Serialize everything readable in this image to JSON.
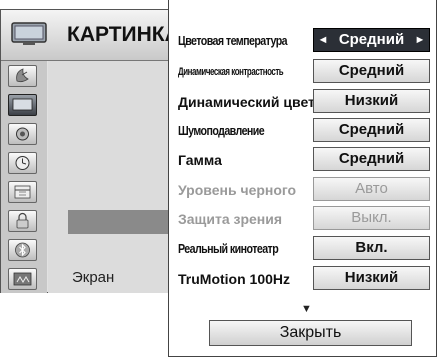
{
  "header": {
    "title": "КАРТИНКА"
  },
  "left_menu": {
    "icons": [
      "satellite-dish-icon",
      "picture-icon",
      "speaker-icon",
      "clock-icon",
      "calendar-icon",
      "lock-icon",
      "bluetooth-icon",
      "media-icon"
    ],
    "active_index": 1,
    "screen_label": "Экран"
  },
  "dialog": {
    "rows": [
      {
        "label": "Цветовая температура",
        "value": "Средний",
        "selected": true,
        "disabled": false
      },
      {
        "label": "Динамическая контрастность",
        "value": "Средний",
        "selected": false,
        "disabled": false
      },
      {
        "label": "Динамический цвет",
        "value": "Низкий",
        "selected": false,
        "disabled": false
      },
      {
        "label": "Шумоподавление",
        "value": "Средний",
        "selected": false,
        "disabled": false
      },
      {
        "label": "Гамма",
        "value": "Средний",
        "selected": false,
        "disabled": false
      },
      {
        "label": "Уровень черного",
        "value": "Авто",
        "selected": false,
        "disabled": true
      },
      {
        "label": "Защита зрения",
        "value": "Выкл.",
        "selected": false,
        "disabled": true
      },
      {
        "label": "Реальный кинотеатр",
        "value": "Вкл.",
        "selected": false,
        "disabled": false
      },
      {
        "label": "TruMotion 100Hz",
        "value": "Низкий",
        "selected": false,
        "disabled": false
      }
    ],
    "left_arrow": "◄",
    "right_arrow": "►",
    "scroll_indicator": "▼",
    "close_label": "Закрыть"
  }
}
